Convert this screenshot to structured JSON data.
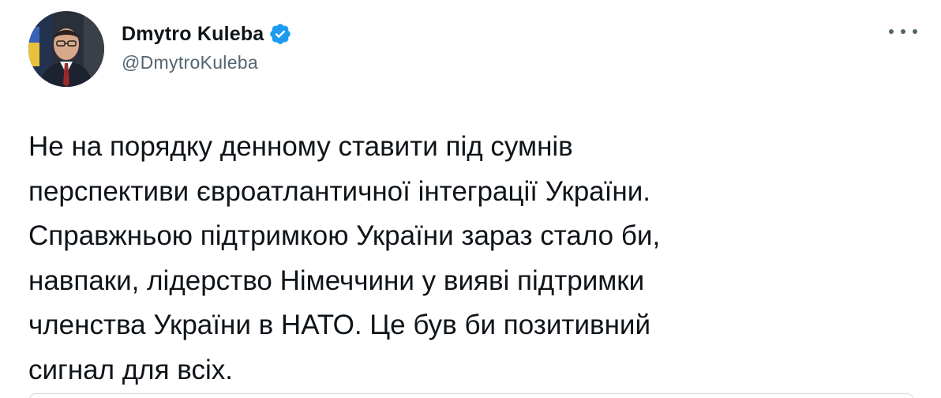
{
  "author": {
    "display_name": "Dmytro Kuleba",
    "handle": "@DmytroKuleba",
    "verified": true,
    "avatar_icon": "profile-photo"
  },
  "tweet": {
    "lines": [
      "Не на порядку денному ставити під сумнів",
      "перспективи євроатлантичної інтеграції України.",
      "Справжньою підтримкою України зараз стало би,",
      "навпаки, лідерство Німеччини у вияві підтримки",
      "членства України в НАТО. Це був би позитивний",
      "сигнал для всіх."
    ]
  },
  "icons": {
    "verified": "verified-badge-icon",
    "more": "more-options-icon"
  },
  "colors": {
    "verified_blue": "#1d9bf0",
    "secondary_text": "#536471",
    "primary_text": "#0f1419",
    "border": "#cfd9de"
  }
}
